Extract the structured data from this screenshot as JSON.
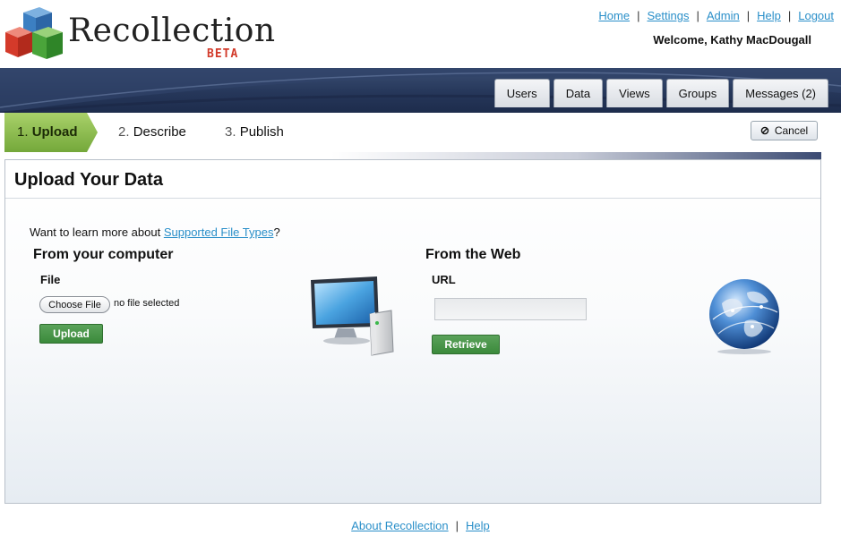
{
  "app": {
    "name": "Recollection",
    "beta": "BETA"
  },
  "toplinks": {
    "home": "Home",
    "settings": "Settings",
    "admin": "Admin",
    "help": "Help",
    "logout": "Logout",
    "sep": "|"
  },
  "welcome": "Welcome, Kathy MacDougall",
  "nav": {
    "tabs": [
      "Users",
      "Data",
      "Views",
      "Groups",
      "Messages (2)"
    ]
  },
  "steps": [
    {
      "num": "1.",
      "label": "Upload",
      "active": true
    },
    {
      "num": "2.",
      "label": "Describe",
      "active": false
    },
    {
      "num": "3.",
      "label": "Publish",
      "active": false
    }
  ],
  "cancel_label": "Cancel",
  "panel": {
    "title": "Upload Your Data",
    "learn_prefix": "Want to learn more about ",
    "learn_link": "Supported File Types",
    "learn_suffix": "?",
    "computer": {
      "heading": "From your computer",
      "file_label": "File",
      "choose_button": "Choose File",
      "no_file": "no file selected",
      "upload_button": "Upload"
    },
    "web": {
      "heading": "From the Web",
      "url_label": "URL",
      "url_value": "",
      "retrieve_button": "Retrieve"
    }
  },
  "footer": {
    "about": "About Recollection",
    "help": "Help",
    "sep": "|"
  },
  "colors": {
    "brand_navy": "#26375a",
    "step_green": "#8bbd4a",
    "button_green": "#3b8a3b",
    "link_blue": "#2a8fc9",
    "beta_red": "#d23a2a"
  },
  "icons": [
    "cube-logo-icon",
    "cancel-icon",
    "computer-icon",
    "globe-icon"
  ]
}
